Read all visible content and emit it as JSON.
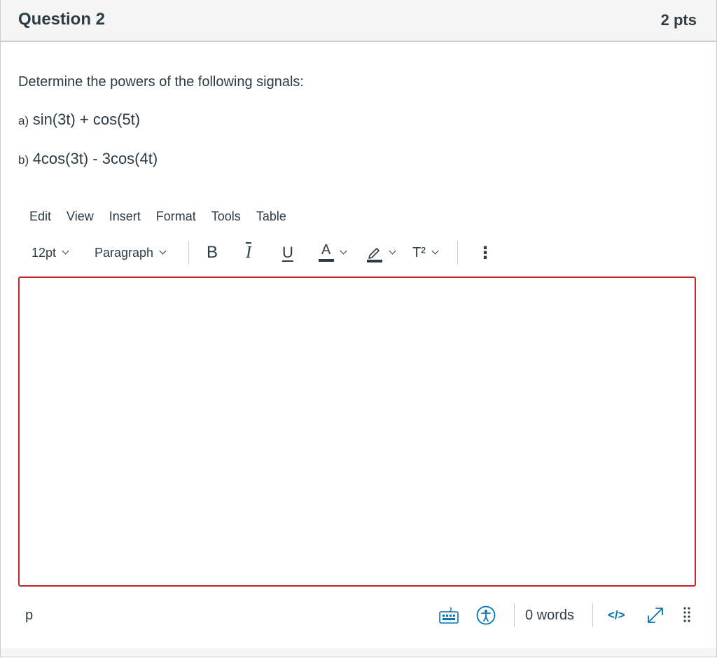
{
  "question": {
    "title": "Question 2",
    "points": "2 pts",
    "prompt": "Determine the powers of the following signals:",
    "parts": [
      {
        "prefix": "a)",
        "formula": "sin(3t) + cos(5t)"
      },
      {
        "prefix": "b)",
        "formula": "4cos(3t) - 3cos(4t)"
      }
    ]
  },
  "editor": {
    "menu": [
      "Edit",
      "View",
      "Insert",
      "Format",
      "Tools",
      "Table"
    ],
    "toolbar": {
      "font_size": "12pt",
      "block_format": "Paragraph",
      "bold_label": "B",
      "italic_label": "I",
      "underline_label": "U",
      "text_color_label": "A",
      "superscript_label": "T²",
      "more_label": "⋮"
    },
    "content": "",
    "status": {
      "path": "p",
      "word_count": "0 words",
      "html_label": "</>"
    },
    "colors": {
      "focus_border": "#c0272d",
      "accent": "#0374b5",
      "text": "#2d3b45"
    }
  }
}
